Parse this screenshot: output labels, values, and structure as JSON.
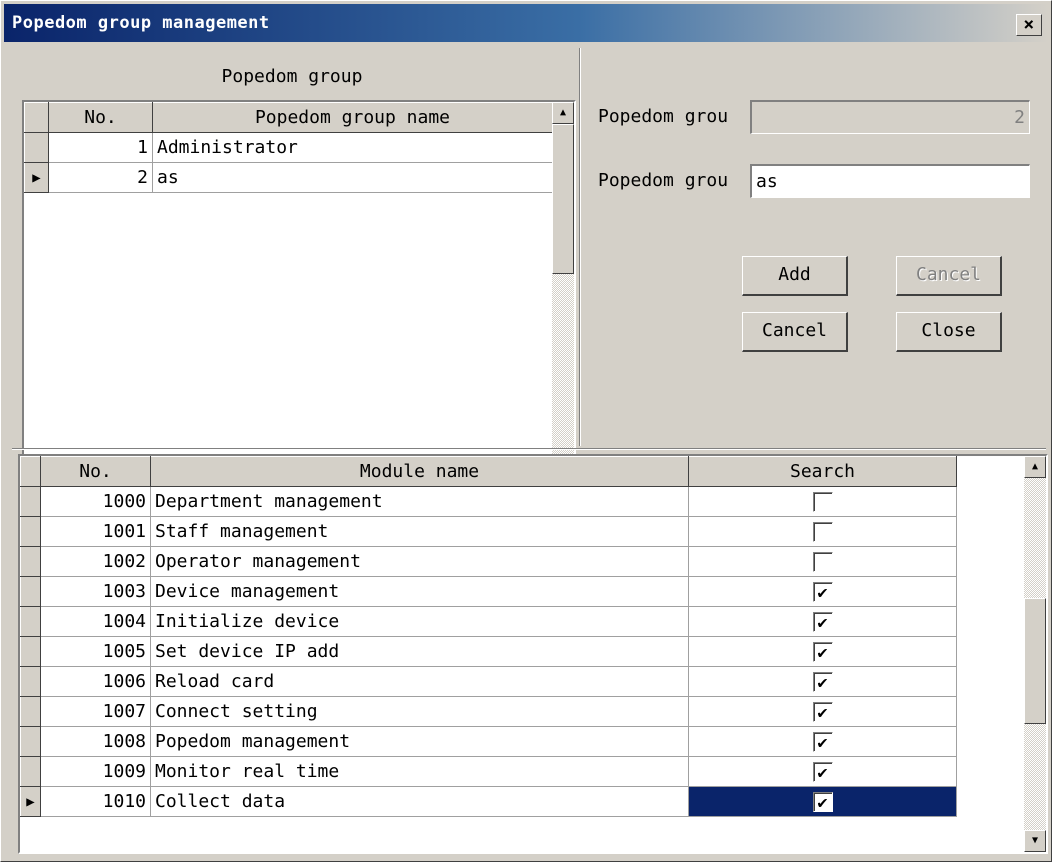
{
  "window": {
    "title": "Popedom group management",
    "close_label": "×"
  },
  "group_panel": {
    "caption": "Popedom group",
    "columns": {
      "no": "No.",
      "name": "Popedom group name"
    },
    "rows": [
      {
        "no": "1",
        "name": "Administrator",
        "indicator": ""
      },
      {
        "no": "2",
        "name": "as",
        "indicator": "▶"
      }
    ]
  },
  "form": {
    "number_label": "Popedom grou",
    "number_value": "2",
    "name_label": "Popedom grou",
    "name_value": "as"
  },
  "buttons": {
    "add": "Add",
    "cancel_top": "Cancel",
    "cancel": "Cancel",
    "close": "Close"
  },
  "modules": {
    "columns": {
      "no": "No.",
      "name": "Module name",
      "search": "Search"
    },
    "rows": [
      {
        "no": "1000",
        "name": "Department management",
        "search": ""
      },
      {
        "no": "1001",
        "name": "Staff management",
        "search": ""
      },
      {
        "no": "1002",
        "name": "Operator management",
        "search": ""
      },
      {
        "no": "1003",
        "name": "Device management",
        "search": "✔"
      },
      {
        "no": "1004",
        "name": "Initialize device",
        "search": "✔"
      },
      {
        "no": "1005",
        "name": "Set device IP add",
        "search": "✔"
      },
      {
        "no": "1006",
        "name": "Reload card",
        "search": "✔"
      },
      {
        "no": "1007",
        "name": "Connect setting",
        "search": "✔"
      },
      {
        "no": "1008",
        "name": "Popedom management",
        "search": "✔"
      },
      {
        "no": "1009",
        "name": "Monitor real time",
        "search": "✔"
      },
      {
        "no": "1010",
        "name": "Collect data",
        "search": "✔"
      }
    ],
    "selected_row_indicator": "▶"
  },
  "icons": {
    "scroll_up": "▲",
    "scroll_down": "▼"
  }
}
